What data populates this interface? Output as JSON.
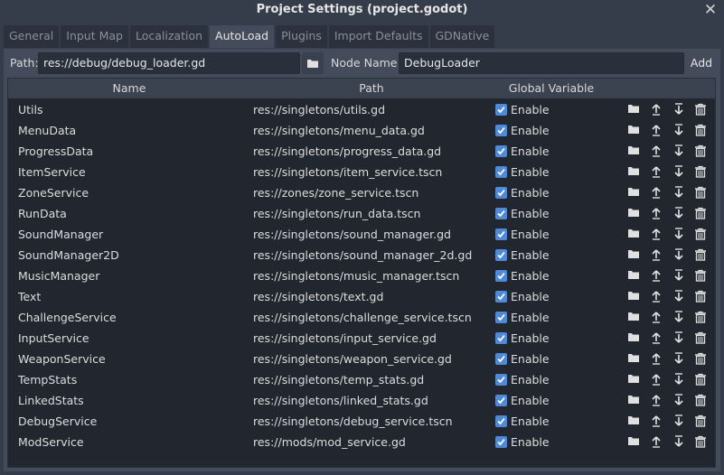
{
  "window": {
    "title": "Project Settings (project.godot)"
  },
  "tabs": [
    {
      "label": "General",
      "active": false
    },
    {
      "label": "Input Map",
      "active": false
    },
    {
      "label": "Localization",
      "active": false
    },
    {
      "label": "AutoLoad",
      "active": true
    },
    {
      "label": "Plugins",
      "active": false
    },
    {
      "label": "Import Defaults",
      "active": false
    },
    {
      "label": "GDNative",
      "active": false
    }
  ],
  "toolbar": {
    "path_label": "Path:",
    "path_value": "res://debug/debug_loader.gd",
    "node_name_label": "Node Name:",
    "node_name_value": "DebugLoader",
    "add_label": "Add"
  },
  "table": {
    "headers": {
      "name": "Name",
      "path": "Path",
      "global": "Global Variable"
    },
    "enable_label": "Enable",
    "rows": [
      {
        "name": "Utils",
        "path": "res://singletons/utils.gd",
        "enabled": true
      },
      {
        "name": "MenuData",
        "path": "res://singletons/menu_data.gd",
        "enabled": true
      },
      {
        "name": "ProgressData",
        "path": "res://singletons/progress_data.gd",
        "enabled": true
      },
      {
        "name": "ItemService",
        "path": "res://singletons/item_service.tscn",
        "enabled": true
      },
      {
        "name": "ZoneService",
        "path": "res://zones/zone_service.tscn",
        "enabled": true
      },
      {
        "name": "RunData",
        "path": "res://singletons/run_data.tscn",
        "enabled": true
      },
      {
        "name": "SoundManager",
        "path": "res://singletons/sound_manager.gd",
        "enabled": true
      },
      {
        "name": "SoundManager2D",
        "path": "res://singletons/sound_manager_2d.gd",
        "enabled": true
      },
      {
        "name": "MusicManager",
        "path": "res://singletons/music_manager.tscn",
        "enabled": true
      },
      {
        "name": "Text",
        "path": "res://singletons/text.gd",
        "enabled": true
      },
      {
        "name": "ChallengeService",
        "path": "res://singletons/challenge_service.tscn",
        "enabled": true
      },
      {
        "name": "InputService",
        "path": "res://singletons/input_service.gd",
        "enabled": true
      },
      {
        "name": "WeaponService",
        "path": "res://singletons/weapon_service.gd",
        "enabled": true
      },
      {
        "name": "TempStats",
        "path": "res://singletons/temp_stats.gd",
        "enabled": true
      },
      {
        "name": "LinkedStats",
        "path": "res://singletons/linked_stats.gd",
        "enabled": true
      },
      {
        "name": "DebugService",
        "path": "res://singletons/debug_service.tscn",
        "enabled": true
      },
      {
        "name": "ModService",
        "path": "res://mods/mod_service.gd",
        "enabled": true
      }
    ]
  },
  "icons": {
    "close": "close-icon",
    "folder": "folder-icon",
    "move_up": "arrow-up-icon",
    "move_down": "arrow-down-icon",
    "delete": "trash-icon",
    "checkbox": "checkbox-checked-icon"
  },
  "colors": {
    "accent": "#4f8ad8",
    "background": "#363d4a",
    "panel": "#444c5b",
    "table_bg": "#22272f"
  }
}
